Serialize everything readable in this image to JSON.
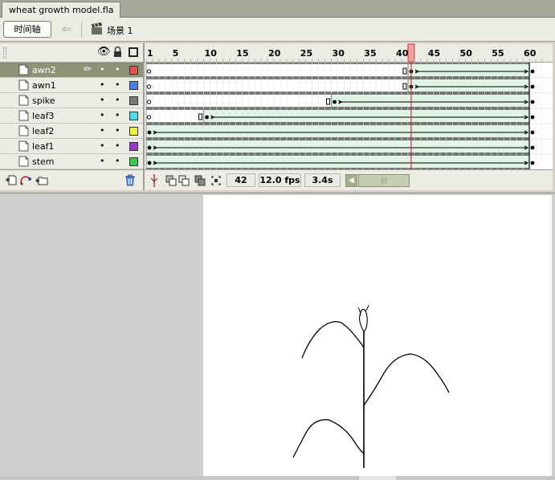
{
  "document": {
    "tab_title": "wheat growth model.fla"
  },
  "toolbar": {
    "timeline_button": "时间轴",
    "scene_label": "场景 1",
    "back_icon": "left-arrow-icon",
    "scene_icon": "clapperboard-icon"
  },
  "layer_header": {
    "eye_icon": "eye-icon",
    "lock_icon": "lock-icon",
    "outline_icon": "outline-square-icon"
  },
  "timeline": {
    "ruler_labels": [
      "1",
      "5",
      "10",
      "15",
      "20",
      "25",
      "30",
      "35",
      "40",
      "45",
      "50",
      "55",
      "60"
    ],
    "current_frame": 42,
    "last_frame": 61
  },
  "layers": [
    {
      "name": "awn2",
      "color": "#e85050",
      "selected": true,
      "keyframe_at": 42,
      "tween": "shape"
    },
    {
      "name": "awn1",
      "color": "#4a7fe8",
      "selected": false,
      "keyframe_at": 42,
      "tween": "shape"
    },
    {
      "name": "spike",
      "color": "#7a7a7a",
      "selected": false,
      "keyframe_at": 30,
      "tween": "shape"
    },
    {
      "name": "leaf3",
      "color": "#4de0e8",
      "selected": false,
      "keyframe_at": 10,
      "tween": "shape"
    },
    {
      "name": "leaf2",
      "color": "#f0f040",
      "selected": false,
      "keyframe_at": 1,
      "tween": "shape"
    },
    {
      "name": "leaf1",
      "color": "#9a38c8",
      "selected": false,
      "keyframe_at": 1,
      "tween": "shape"
    },
    {
      "name": "stem",
      "color": "#38c850",
      "selected": false,
      "keyframe_at": 1,
      "tween": "shape"
    }
  ],
  "status": {
    "frame": "42",
    "fps": "12.0 fps",
    "time": "3.4s"
  },
  "bottom_tools": {
    "add_layer_icon": "add-layer-icon",
    "add_guide_icon": "add-guide-icon",
    "add_folder_icon": "add-folder-icon",
    "delete_icon": "trash-icon"
  },
  "colors": {
    "tween": "#e0f5e6",
    "playhead": "#cc3333",
    "selected_row": "#8e9276"
  }
}
